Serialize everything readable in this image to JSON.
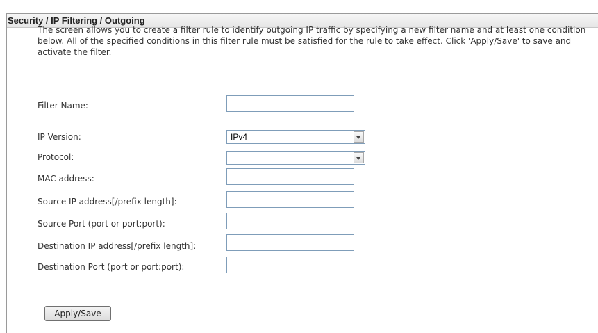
{
  "page": {
    "title": "Security / IP Filtering / Outgoing",
    "description": "The screen allows you to create a filter rule to identify outgoing IP traffic by specifying a new filter name and at least one condition below. All of the specified conditions in this filter rule must be satisfied for the rule to take effect. Click 'Apply/Save' to save and activate the filter."
  },
  "form": {
    "filter_name": {
      "label": "Filter Name:",
      "value": ""
    },
    "ip_version": {
      "label": "IP Version:",
      "selected": "IPv4"
    },
    "protocol": {
      "label": "Protocol:",
      "selected": ""
    },
    "mac_address": {
      "label": "MAC address:",
      "value": ""
    },
    "source_ip": {
      "label": "Source IP address[/prefix length]:",
      "value": ""
    },
    "source_port": {
      "label": "Source Port (port or port:port):",
      "value": ""
    },
    "destination_ip": {
      "label": "Destination IP address[/prefix length]:",
      "value": ""
    },
    "destination_port": {
      "label": "Destination Port (port or port:port):",
      "value": ""
    }
  },
  "actions": {
    "apply_save_label": "Apply/Save"
  },
  "icons": {
    "select_arrow": "chevron-down-icon"
  }
}
